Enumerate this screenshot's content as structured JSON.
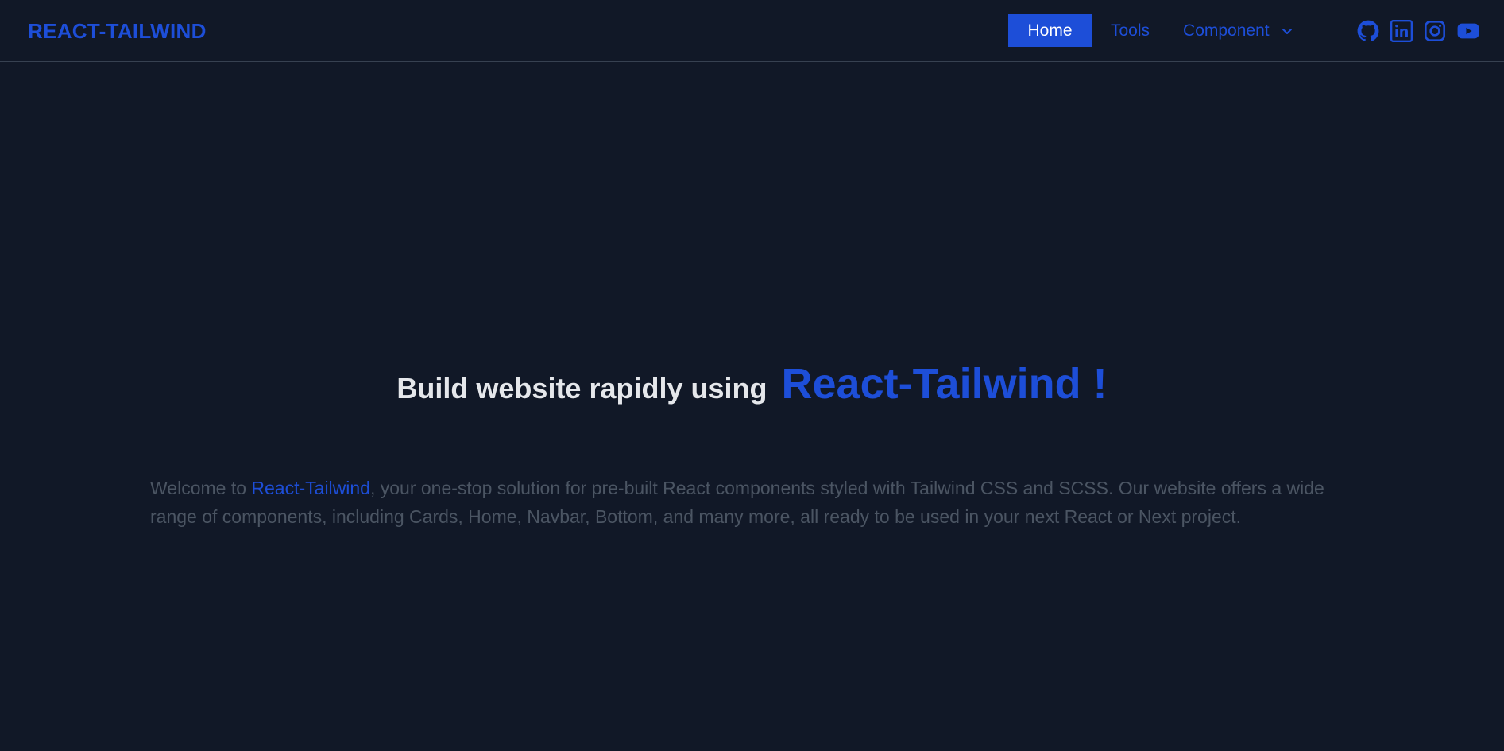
{
  "brand": {
    "label": "REACT-TAILWIND"
  },
  "nav": {
    "items": [
      {
        "label": "Home",
        "active": true
      },
      {
        "label": "Tools",
        "active": false
      },
      {
        "label": "Component",
        "active": false,
        "has_dropdown": true
      }
    ]
  },
  "social": {
    "icons": [
      "github-icon",
      "linkedin-icon",
      "instagram-icon",
      "youtube-icon"
    ]
  },
  "hero": {
    "title_prefix": "Build website rapidly using",
    "title_accent": "React-Tailwind !"
  },
  "intro": {
    "prefix": "Welcome to ",
    "link": "React-Tailwind",
    "suffix": ", your one-stop solution for pre-built React components styled with Tailwind CSS and SCSS. Our website offers a wide range of components, including Cards, Home, Navbar, Bottom, and many more, all ready to be used in your next React or Next project."
  },
  "colors": {
    "background": "#111827",
    "accent": "#1d4ed8",
    "heading": "#e5e7eb",
    "muted_text": "#4b5563",
    "divider": "#374151"
  }
}
